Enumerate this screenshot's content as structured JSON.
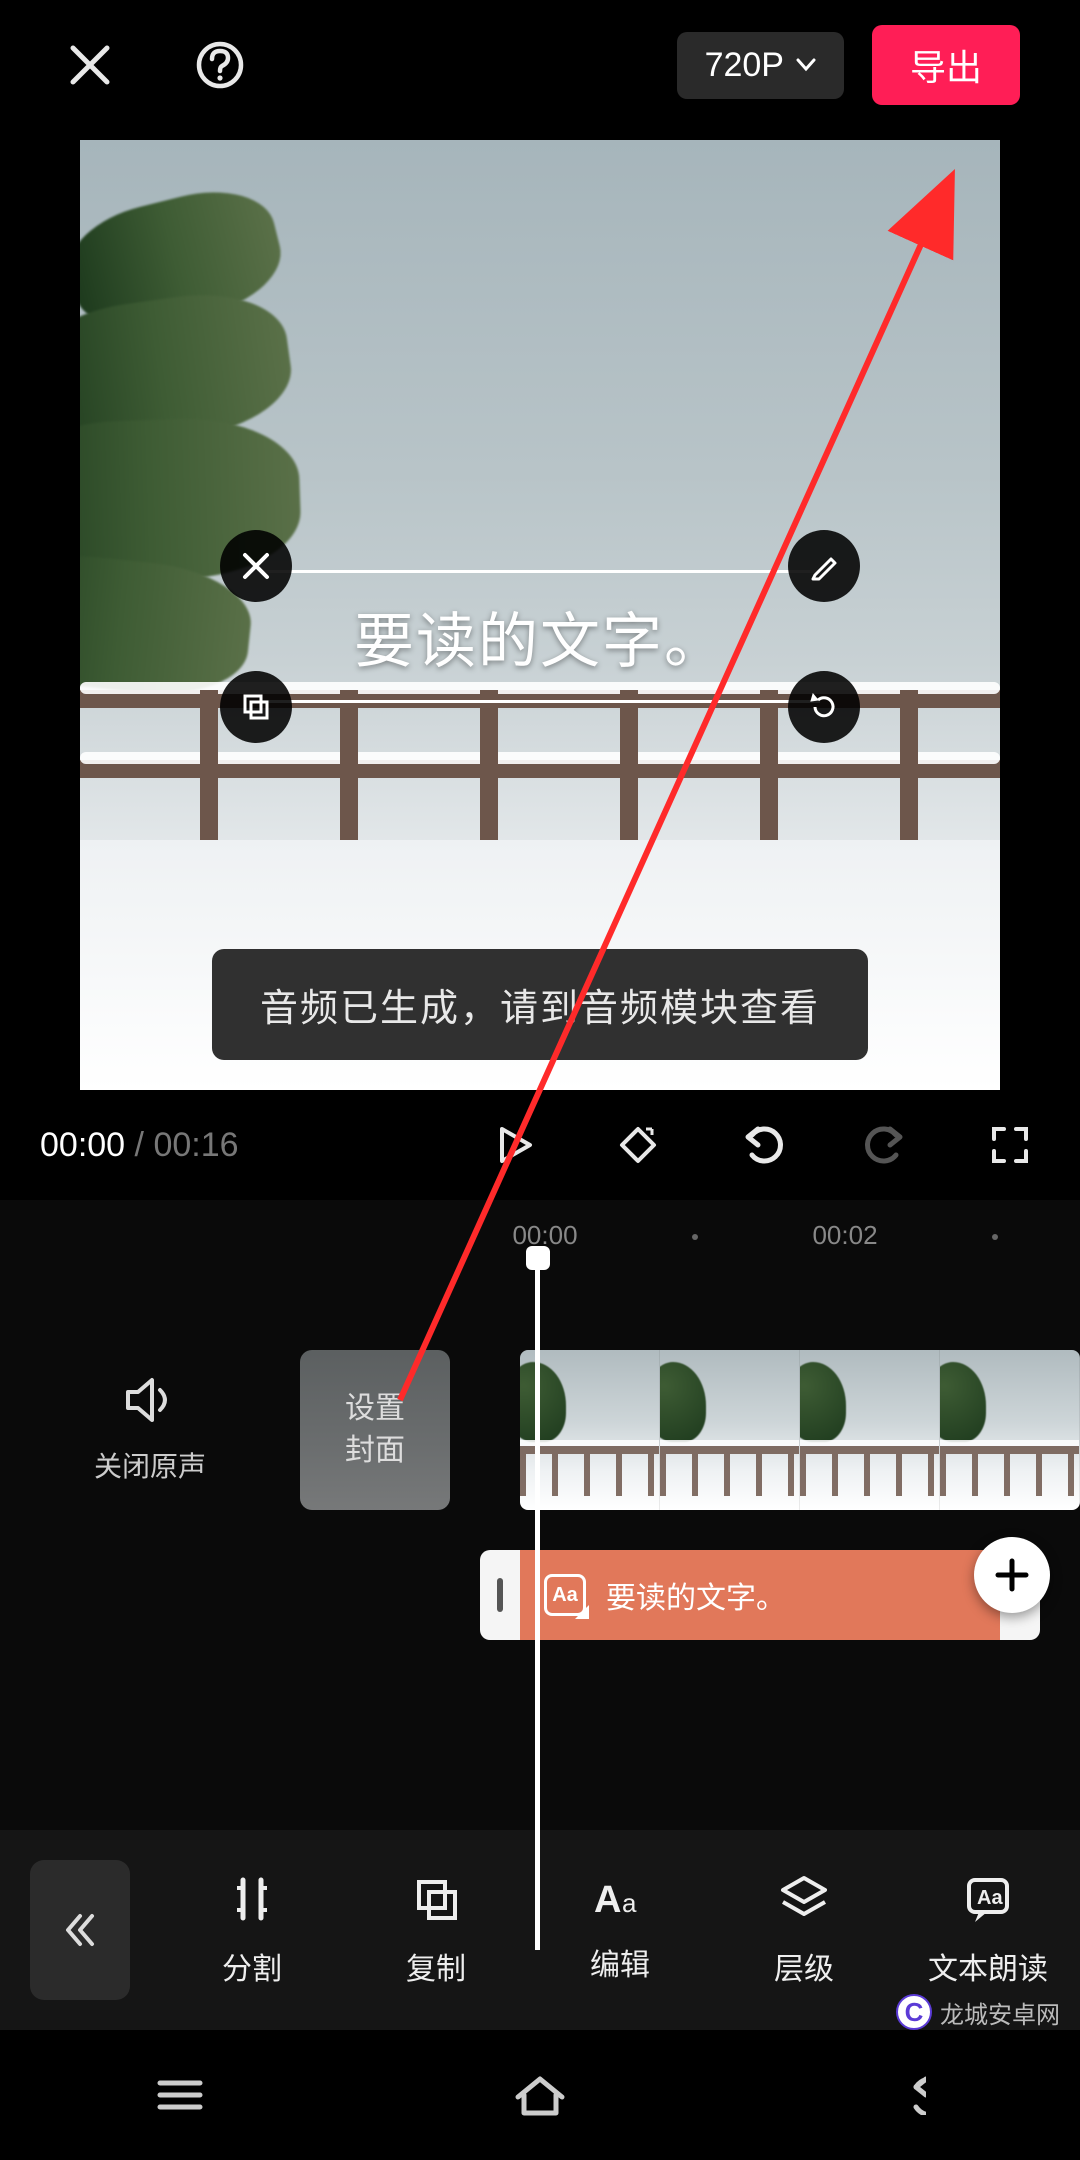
{
  "header": {
    "resolution_label": "720P",
    "export_label": "导出"
  },
  "preview": {
    "text_overlay": "要读的文字。",
    "toast": "音频已生成，请到音频模块查看"
  },
  "transport": {
    "current_time": "00:00",
    "duration": "00:16"
  },
  "timeline": {
    "ruler": {
      "t0": "00:00",
      "t1": "00:02"
    },
    "mute_label": "关闭原声",
    "cover_line1": "设置",
    "cover_line2": "封面",
    "text_clip_label": "要读的文字。",
    "text_badge": "Aa"
  },
  "toolbar": {
    "split": "分割",
    "copy": "复制",
    "edit": "编辑",
    "layer": "层级",
    "tts": "文本朗读"
  },
  "watermark": {
    "text": "龙城安卓网"
  }
}
